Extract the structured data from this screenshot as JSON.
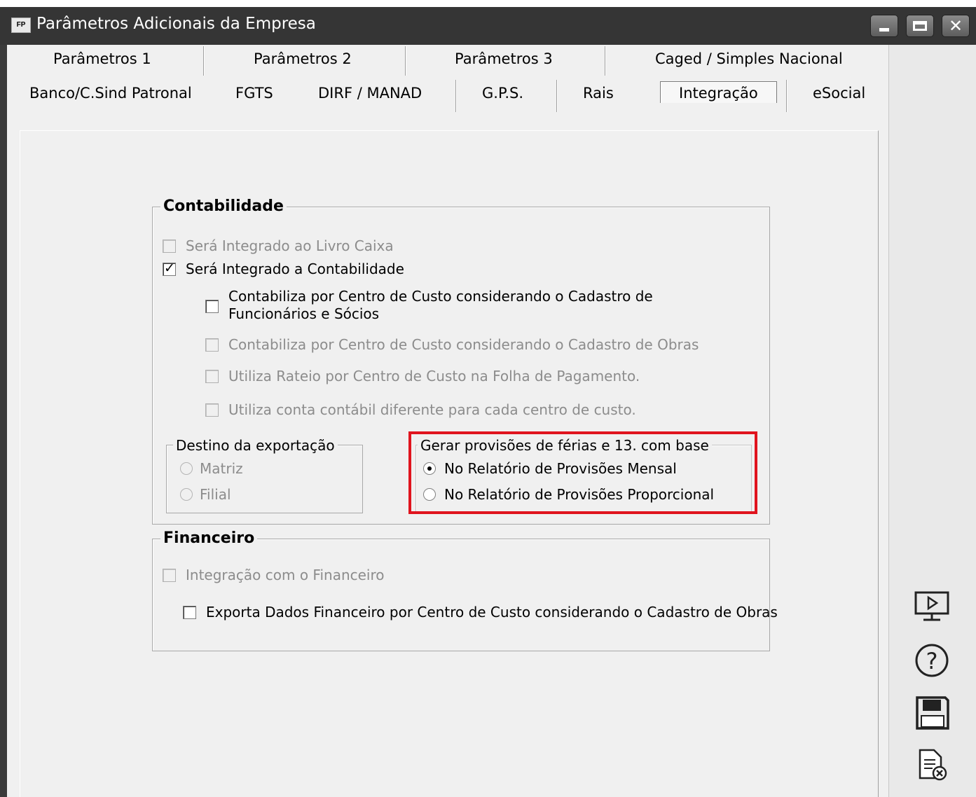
{
  "window": {
    "app_icon": "FP",
    "title": "Parâmetros Adicionais da Empresa"
  },
  "tabs": {
    "row1": [
      "Parâmetros 1",
      "Parâmetros 2",
      "Parâmetros 3",
      "Caged / Simples Nacional"
    ],
    "row2": [
      "Banco/C.Sind Patronal",
      "FGTS",
      "DIRF / MANAD",
      "G.P.S.",
      "Rais",
      "Integração",
      "eSocial"
    ],
    "active": "Integração"
  },
  "contabilidade": {
    "title": "Contabilidade",
    "livro_caixa": {
      "label": "Será Integrado ao Livro Caixa",
      "checked": false,
      "enabled": false
    },
    "contabilidade": {
      "label": "Será Integrado a Contabilidade",
      "checked": true,
      "enabled": true
    },
    "centro_custo_funcionarios": {
      "label": "Contabiliza por Centro de Custo considerando o Cadastro de Funcionários e Sócios",
      "checked": false,
      "enabled": true
    },
    "centro_custo_obras": {
      "label": "Contabiliza por Centro de Custo considerando o Cadastro de Obras",
      "checked": false,
      "enabled": false
    },
    "rateio": {
      "label": "Utiliza Rateio por Centro de Custo na Folha de Pagamento.",
      "checked": false,
      "enabled": false
    },
    "conta_contabil": {
      "label": "Utiliza conta contábil diferente para cada centro de custo.",
      "checked": false,
      "enabled": false
    },
    "destino": {
      "title": "Destino da exportação",
      "options": [
        {
          "label": "Matriz",
          "selected": false,
          "enabled": false
        },
        {
          "label": "Filial",
          "selected": false,
          "enabled": false
        }
      ]
    },
    "provisoes": {
      "title": "Gerar provisões de férias e 13. com base",
      "options": [
        {
          "label": "No Relatório de Provisões Mensal",
          "selected": true,
          "enabled": true
        },
        {
          "label": "No Relatório de Provisões Proporcional",
          "selected": false,
          "enabled": true
        }
      ],
      "highlight_color": "#e0141e"
    }
  },
  "financeiro": {
    "title": "Financeiro",
    "integracao": {
      "label": "Integração com o Financeiro",
      "checked": false,
      "enabled": false
    },
    "exporta": {
      "label": "Exporta Dados Financeiro por Centro de Custo considerando o Cadastro de Obras",
      "checked": false,
      "enabled": true
    }
  },
  "sidebar_icons": [
    "monitor-play-icon",
    "help-icon",
    "save-icon",
    "cancel-document-icon"
  ]
}
